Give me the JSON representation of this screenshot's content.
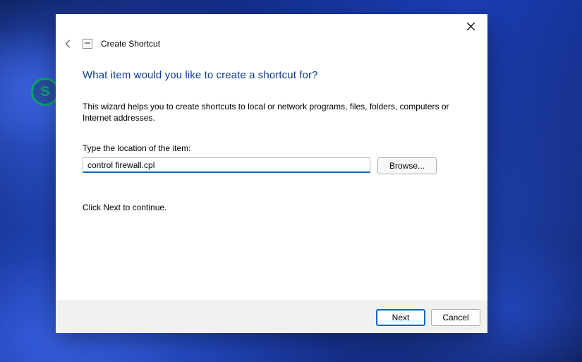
{
  "header": {
    "title": "Create Shortcut"
  },
  "main": {
    "heading": "What item would you like to create a shortcut for?",
    "description": "This wizard helps you to create shortcuts to local or network programs, files, folders, computers or Internet addresses.",
    "field_label": "Type the location of the item:",
    "location_value": "control firewall.cpl",
    "browse_label": "Browse...",
    "hint": "Click Next to continue."
  },
  "footer": {
    "next_label": "Next",
    "cancel_label": "Cancel"
  }
}
